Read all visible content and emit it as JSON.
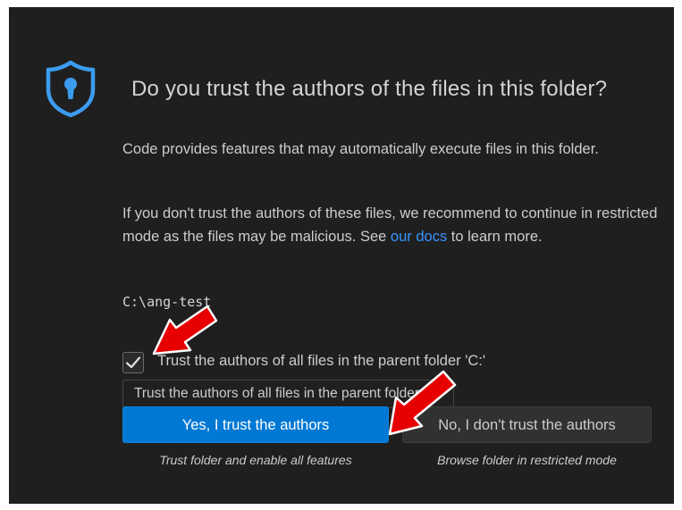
{
  "dialog": {
    "title": "Do you trust the authors of the files in this folder?",
    "paragraph1": "Code provides features that may automatically execute files in this folder.",
    "paragraph2_before": "If you don't trust the authors of these files, we recommend to continue in restricted mode as the files may be malicious. See ",
    "paragraph2_link": "our docs",
    "paragraph2_after": " to learn more.",
    "folder_path": "C:\\ang-test",
    "checkbox_label": "Trust the authors of all files in the parent folder 'C:'",
    "checkbox_checked": true,
    "tooltip": "Trust the authors of all files in the parent folder 'C:'",
    "trust_button": "Yes, I trust the authors",
    "trust_sub": "Trust folder and enable all features",
    "distrust_button": "No, I don't trust the authors",
    "distrust_sub": "Browse folder in restricted mode"
  },
  "colors": {
    "background": "#1f1f1f",
    "primary_button": "#0078d4",
    "secondary_button": "#313131",
    "link": "#3794ff",
    "shield": "#3c9cf0",
    "annotation_arrow": "#e60000"
  },
  "icons": [
    "shield-keyhole-icon",
    "checkmark-icon",
    "red-arrow-annotation"
  ]
}
